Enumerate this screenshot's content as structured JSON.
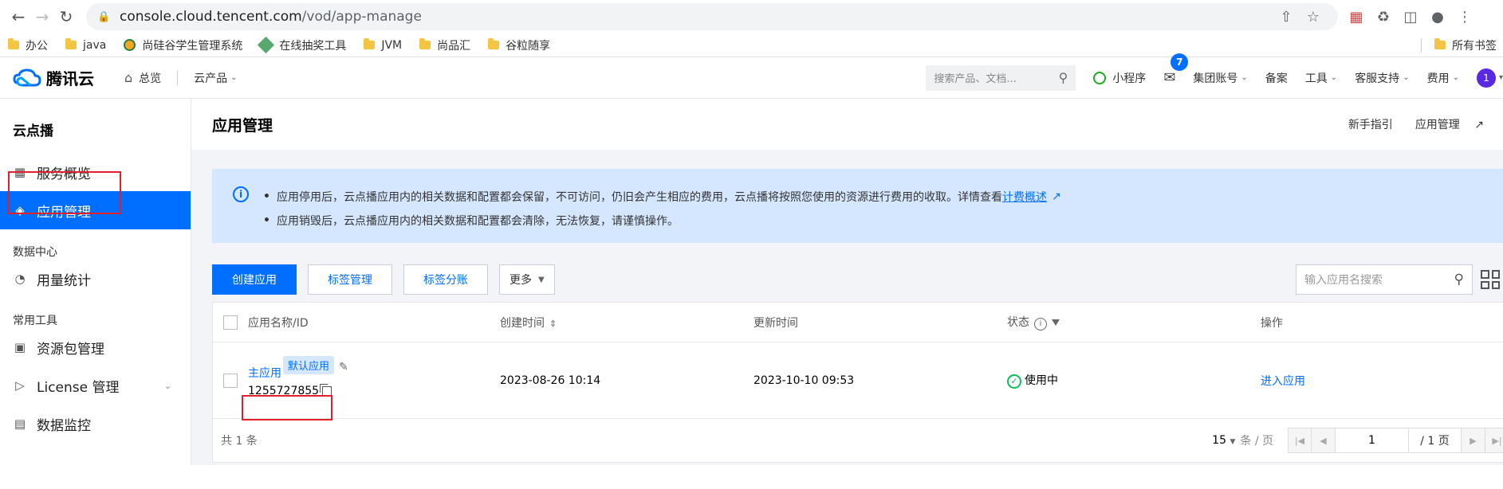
{
  "browser": {
    "url_host": "console.cloud.tencent.com",
    "url_path": "/vod/app-manage"
  },
  "bookmarks": {
    "items": [
      {
        "label": "办公",
        "icon": "folder-icon"
      },
      {
        "label": "java",
        "icon": "folder-icon"
      },
      {
        "label": "尚硅谷学生管理系统",
        "icon": "site-icon"
      },
      {
        "label": "在线抽奖工具",
        "icon": "site-icon"
      },
      {
        "label": "JVM",
        "icon": "folder-icon"
      },
      {
        "label": "尚品汇",
        "icon": "folder-icon"
      },
      {
        "label": "谷粒随享",
        "icon": "folder-icon"
      }
    ],
    "all_bookmarks": "所有书签"
  },
  "header": {
    "logo_text": "腾讯云",
    "overview": "总览",
    "products": "云产品",
    "search_placeholder": "搜索产品、文档...",
    "mini_program": "小程序",
    "mail_badge": "7",
    "group_account": "集团账号",
    "beian": "备案",
    "tools": "工具",
    "support": "客服支持",
    "billing": "费用",
    "avatar": "1"
  },
  "sidebar": {
    "title": "云点播",
    "overview": "服务概览",
    "app_manage": "应用管理",
    "group_data": "数据中心",
    "usage": "用量统计",
    "group_tools": "常用工具",
    "resource_pkg": "资源包管理",
    "license": "License 管理",
    "monitor": "数据监控"
  },
  "page": {
    "title": "应用管理",
    "guide": "新手指引",
    "doc_link": "应用管理"
  },
  "notice": {
    "line1": "应用停用后，云点播应用内的相关数据和配置都会保留，不可访问，仍旧会产生相应的费用，云点播将按照您使用的资源进行费用的收取。详情查看",
    "line1_link": "计费概述",
    "line2": "应用销毁后，云点播应用内的相关数据和配置都会清除，无法恢复，请谨慎操作。"
  },
  "toolbar": {
    "create": "创建应用",
    "tag_manage": "标签管理",
    "tag_split": "标签分账",
    "more": "更多",
    "search_placeholder": "输入应用名搜索"
  },
  "table": {
    "headers": {
      "name": "应用名称/ID",
      "created": "创建时间",
      "updated": "更新时间",
      "status": "状态",
      "action": "操作"
    },
    "rows": [
      {
        "name": "主应用",
        "tag": "默认应用",
        "id": "1255727855",
        "created": "2023-08-26 10:14",
        "updated": "2023-10-10 09:53",
        "status": "使用中",
        "action": "进入应用"
      }
    ]
  },
  "pager": {
    "total": "共 1 条",
    "page_size": "15",
    "per_page": "条 / 页",
    "current": "1",
    "pages": "/ 1 页"
  },
  "colors": {
    "brand_blue": "#006eff",
    "highlight_red": "#e0202a",
    "status_green": "#0abf5b"
  }
}
